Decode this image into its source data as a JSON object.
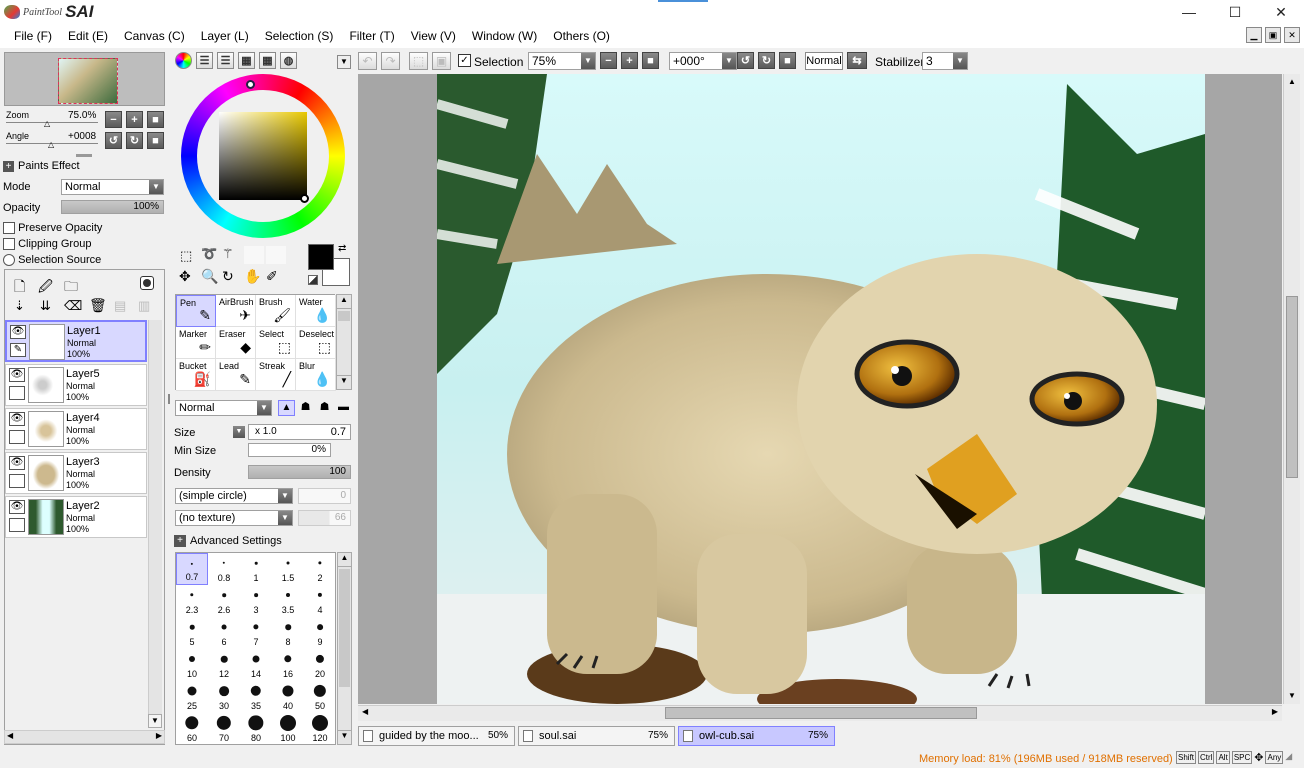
{
  "app": {
    "logo_small": "PaintTool",
    "logo_big": "SAI"
  },
  "window_controls": {
    "minimize": "—",
    "maximize": "☐",
    "close": "✕"
  },
  "menu": [
    "File (F)",
    "Edit (E)",
    "Canvas (C)",
    "Layer (L)",
    "Selection (S)",
    "Filter (T)",
    "View (V)",
    "Window (W)",
    "Others (O)"
  ],
  "navigator": {
    "zoom_label": "Zoom",
    "zoom_value": "75.0%",
    "angle_label": "Angle",
    "angle_value": "+0008"
  },
  "layer_props": {
    "paints_effect": "Paints Effect",
    "mode_label": "Mode",
    "mode_value": "Normal",
    "opacity_label": "Opacity",
    "opacity_value": "100%",
    "preserve_opacity": "Preserve Opacity",
    "clipping_group": "Clipping Group",
    "selection_source": "Selection Source"
  },
  "layers": [
    {
      "name": "Layer1",
      "mode": "Normal",
      "opacity": "100%",
      "selected": true
    },
    {
      "name": "Layer5",
      "mode": "Normal",
      "opacity": "100%",
      "selected": false
    },
    {
      "name": "Layer4",
      "mode": "Normal",
      "opacity": "100%",
      "selected": false
    },
    {
      "name": "Layer3",
      "mode": "Normal",
      "opacity": "100%",
      "selected": false
    },
    {
      "name": "Layer2",
      "mode": "Normal",
      "opacity": "100%",
      "selected": false
    }
  ],
  "tools": [
    {
      "label": "Pen",
      "icon": "✎",
      "selected": true
    },
    {
      "label": "AirBrush",
      "icon": "✈",
      "selected": false
    },
    {
      "label": "Brush",
      "icon": "🖌",
      "selected": false
    },
    {
      "label": "Water",
      "icon": "💧",
      "selected": false
    },
    {
      "label": "Marker",
      "icon": "✏",
      "selected": false
    },
    {
      "label": "Eraser",
      "icon": "◆",
      "selected": false
    },
    {
      "label": "Select",
      "icon": "⬚",
      "selected": false
    },
    {
      "label": "Deselect",
      "icon": "⬚",
      "selected": false
    },
    {
      "label": "Bucket",
      "icon": "⛽",
      "selected": false
    },
    {
      "label": "Lead",
      "icon": "✎",
      "selected": false
    },
    {
      "label": "Streak",
      "icon": "╱",
      "selected": false
    },
    {
      "label": "Blur",
      "icon": "💧",
      "selected": false
    }
  ],
  "brush": {
    "blend_mode": "Normal",
    "size_label": "Size",
    "size_mult": "x 1.0",
    "size_value": "0.7",
    "min_size_label": "Min Size",
    "min_size_value": "0%",
    "density_label": "Density",
    "density_value": "100",
    "shape": "(simple circle)",
    "shape_value": "0",
    "texture": "(no texture)",
    "texture_value": "66",
    "advanced": "Advanced Settings",
    "sizes": [
      "0.7",
      "0.8",
      "1",
      "1.5",
      "2",
      "2.3",
      "2.6",
      "3",
      "3.5",
      "4",
      "5",
      "6",
      "7",
      "8",
      "9",
      "10",
      "12",
      "14",
      "16",
      "20",
      "25",
      "30",
      "35",
      "40",
      "50",
      "60",
      "70",
      "80",
      "100",
      "120"
    ]
  },
  "canvas_toolbar": {
    "selection_label": "Selection",
    "zoom": "75%",
    "rotation": "+000°",
    "mode": "Normal",
    "stabilizer_label": "Stabilizer",
    "stabilizer_value": "3"
  },
  "doc_tabs": [
    {
      "name": "guided by the moo...",
      "zoom": "50%",
      "active": false
    },
    {
      "name": "soul.sai",
      "zoom": "75%",
      "active": false
    },
    {
      "name": "owl-cub.sai",
      "zoom": "75%",
      "active": true
    }
  ],
  "status": {
    "memory": "Memory load: 81% (196MB used / 918MB reserved)",
    "keys": [
      "Shift",
      "Ctrl",
      "Alt",
      "SPC",
      "Any"
    ]
  },
  "colors": {
    "accent": "#8080ff",
    "memory_text": "#e07000",
    "primary_color": "#000000",
    "secondary_color": "#ffffff"
  }
}
